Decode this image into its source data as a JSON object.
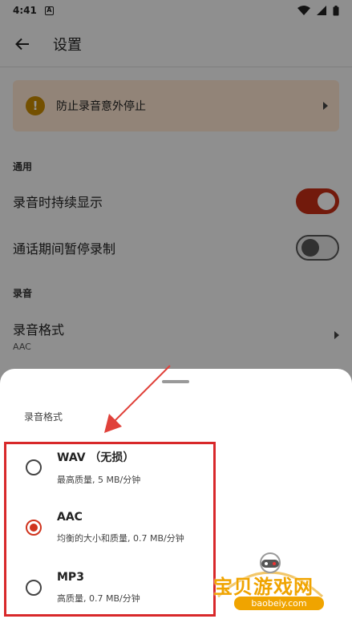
{
  "status_bar": {
    "time": "4:41",
    "notif_letter": "A"
  },
  "app_bar": {
    "title": "设置"
  },
  "warning_card": {
    "text": "防止录音意外停止"
  },
  "general": {
    "heading": "通用",
    "items": [
      {
        "label": "录音时持续显示",
        "enabled": true
      },
      {
        "label": "通话期间暂停录制",
        "enabled": false
      }
    ]
  },
  "recording": {
    "heading": "录音",
    "format_label": "录音格式",
    "format_value": "AAC"
  },
  "sheet": {
    "title": "录音格式",
    "options": [
      {
        "name": "WAV （无损）",
        "desc": "最高质量, 5 MB/分钟",
        "selected": false
      },
      {
        "name": "AAC",
        "desc": "均衡的大小和质量, 0.7 MB/分钟",
        "selected": true
      },
      {
        "name": "MP3",
        "desc": "高质量, 0.7 MB/分钟",
        "selected": false
      }
    ]
  },
  "watermark": {
    "text": "宝贝游戏网",
    "url": "baobeiy.com"
  },
  "colors": {
    "accent": "#d0341e",
    "switch_on": "#c42d16",
    "warning_bg": "#fbe4cf",
    "annotation": "#d8282a"
  }
}
